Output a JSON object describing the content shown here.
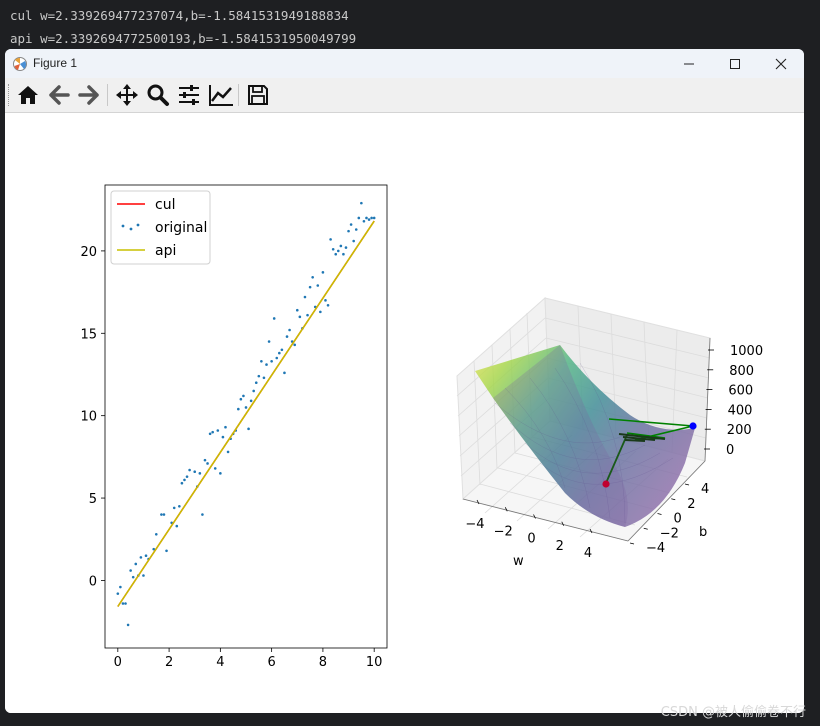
{
  "console": {
    "line1": "cul w=2.339269477237074,b=-1.5841531949188834",
    "line2": "api w=2.3392694772500193,b=-1.5841531950049799"
  },
  "window": {
    "title": "Figure 1",
    "icons": [
      "figure-app-icon",
      "minimize-icon",
      "maximize-icon",
      "close-icon"
    ]
  },
  "toolbar": {
    "buttons": [
      "home-icon",
      "back-icon",
      "forward-icon",
      "pan-icon",
      "zoom-icon",
      "configure-subplots-icon",
      "edit-axis-icon",
      "save-icon"
    ]
  },
  "watermark": "CSDN @被人偷偷卷不行",
  "colors": {
    "cul": "#ff0000",
    "original": "#1f77b4",
    "api": "#c8c000",
    "green": "#008000",
    "blue": "#0000ff",
    "red": "#c00030"
  },
  "chart_data": [
    {
      "type": "scatter",
      "title": "",
      "xlabel": "",
      "ylabel": "",
      "xlim": [
        -0.5,
        10.5
      ],
      "ylim": [
        -4.1,
        24.0
      ],
      "xticks": [
        "0",
        "2",
        "4",
        "6",
        "8",
        "10"
      ],
      "yticks": [
        "0",
        "5",
        "10",
        "15",
        "20"
      ],
      "legend": {
        "position": "top-left",
        "entries": [
          "cul",
          "original",
          "api"
        ]
      },
      "series": [
        {
          "name": "cul",
          "kind": "line",
          "x": [
            0,
            10
          ],
          "y": [
            -1.58,
            21.81
          ]
        },
        {
          "name": "original",
          "kind": "scatter",
          "x": [
            0.0,
            0.1,
            0.2,
            0.3,
            0.4,
            0.5,
            0.6,
            0.7,
            0.8,
            0.9,
            1.0,
            1.1,
            1.2,
            1.4,
            1.5,
            1.7,
            1.8,
            1.9,
            2.1,
            2.2,
            2.3,
            2.4,
            2.5,
            2.6,
            2.7,
            2.8,
            3.0,
            3.1,
            3.2,
            3.3,
            3.4,
            3.5,
            3.6,
            3.7,
            3.8,
            3.9,
            4.0,
            4.1,
            4.2,
            4.3,
            4.4,
            4.5,
            4.6,
            4.7,
            4.8,
            4.9,
            5.0,
            5.1,
            5.2,
            5.3,
            5.4,
            5.5,
            5.6,
            5.7,
            5.8,
            5.9,
            6.0,
            6.1,
            6.2,
            6.3,
            6.4,
            6.5,
            6.6,
            6.7,
            6.8,
            6.9,
            7.0,
            7.1,
            7.2,
            7.3,
            7.4,
            7.5,
            7.6,
            7.7,
            7.8,
            7.9,
            8.0,
            8.1,
            8.2,
            8.3,
            8.4,
            8.5,
            8.6,
            8.7,
            8.8,
            8.9,
            9.0,
            9.1,
            9.2,
            9.3,
            9.4,
            9.5,
            9.6,
            9.7,
            9.8,
            9.9,
            10.0
          ],
          "y": [
            -0.8,
            -0.4,
            -1.4,
            -1.4,
            -2.7,
            0.6,
            0.2,
            1.0,
            0.3,
            1.4,
            0.3,
            1.5,
            1.3,
            1.9,
            2.8,
            4.0,
            4.0,
            1.8,
            3.5,
            4.4,
            3.3,
            4.5,
            5.9,
            6.1,
            6.3,
            6.7,
            6.6,
            5.7,
            6.5,
            4.0,
            7.3,
            7.1,
            8.9,
            9.0,
            6.8,
            9.1,
            6.5,
            8.7,
            9.3,
            7.8,
            8.6,
            8.9,
            9.1,
            10.4,
            11.0,
            11.2,
            10.5,
            9.2,
            10.9,
            11.5,
            12.0,
            12.4,
            13.3,
            12.3,
            13.1,
            14.5,
            13.3,
            15.9,
            13.5,
            13.8,
            14.0,
            12.6,
            14.8,
            15.2,
            14.5,
            14.3,
            16.4,
            16.0,
            15.3,
            17.2,
            16.1,
            17.8,
            18.4,
            16.6,
            17.9,
            16.3,
            18.7,
            17.0,
            16.7,
            20.7,
            20.1,
            19.8,
            20.0,
            20.3,
            19.8,
            20.2,
            21.2,
            21.6,
            20.6,
            21.3,
            22.0,
            22.9,
            21.8,
            22.0,
            21.9,
            22.0,
            22.0
          ]
        },
        {
          "name": "api",
          "kind": "line",
          "x": [
            0,
            10
          ],
          "y": [
            -1.58,
            21.81
          ]
        }
      ]
    },
    {
      "type": "surface3d",
      "title": "",
      "xlabel": "w",
      "ylabel": "b",
      "zlabel": "",
      "xticks": [
        "−4",
        "−2",
        "0",
        "2",
        "4"
      ],
      "yticks": [
        "−4",
        "−2",
        "0",
        "2",
        "4"
      ],
      "zticks": [
        "0",
        "200",
        "400",
        "600",
        "800",
        "1000"
      ],
      "colormap": "viridis"
    }
  ]
}
